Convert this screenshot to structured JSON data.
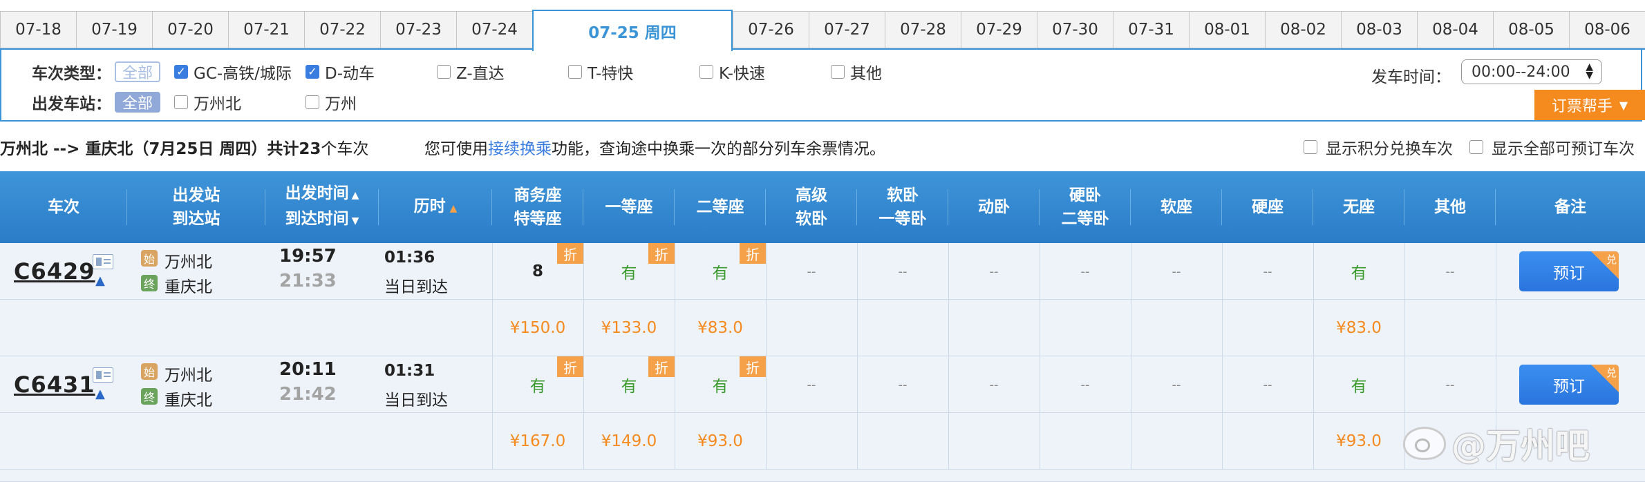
{
  "dates": [
    "07-18",
    "07-19",
    "07-20",
    "07-21",
    "07-22",
    "07-23",
    "07-24",
    "07-25 周四",
    "07-26",
    "07-27",
    "07-28",
    "07-29",
    "07-30",
    "07-31",
    "08-01",
    "08-02",
    "08-03",
    "08-04",
    "08-05",
    "08-06"
  ],
  "active_date_index": 7,
  "filters": {
    "type_label": "车次类型：",
    "all_label": "全部",
    "types": [
      {
        "label": "GC-高铁/城际",
        "checked": true
      },
      {
        "label": "D-动车",
        "checked": true
      },
      {
        "label": "Z-直达",
        "checked": false
      },
      {
        "label": "T-特快",
        "checked": false
      },
      {
        "label": "K-快速",
        "checked": false
      },
      {
        "label": "其他",
        "checked": false
      }
    ],
    "station_label": "出发车站：",
    "stations": [
      {
        "label": "万州北",
        "checked": false
      },
      {
        "label": "万州",
        "checked": false
      }
    ],
    "time_label": "发车时间：",
    "time_value": "00:00--24:00",
    "helper_label": "订票帮手"
  },
  "summary": {
    "route": "万州北 --> 重庆北（7月25日  周四）共计",
    "count": "23",
    "suffix": "个车次",
    "tip_pre": "您可使用",
    "tip_link": "接续换乘",
    "tip_post": "功能，查询途中换乘一次的部分列车余票情况。",
    "opt_points": "显示积分兑换车次",
    "opt_all": "显示全部可预订车次"
  },
  "headers": {
    "train": "车次",
    "station_a": "出发站",
    "station_b": "到达站",
    "time_a": "出发时间",
    "time_b": "到达时间",
    "duration": "历时",
    "business_a": "商务座",
    "business_b": "特等座",
    "first": "一等座",
    "second": "二等座",
    "adv_a": "高级",
    "adv_b": "软卧",
    "soft_a": "软卧",
    "soft_b": "一等卧",
    "moving": "动卧",
    "hard_a": "硬卧",
    "hard_b": "二等卧",
    "softseat": "软座",
    "hardseat": "硬座",
    "noseat": "无座",
    "other": "其他",
    "remark": "备注"
  },
  "trains": [
    {
      "no": "C6429",
      "from": "万州北",
      "to": "重庆北",
      "start_tag": "始",
      "end_tag": "终",
      "dep": "19:57",
      "arr": "21:33",
      "duration": "01:36",
      "arrive_note": "当日到达",
      "business": "8",
      "first": "有",
      "second": "有",
      "noseat": "有",
      "dash": "--",
      "discount": "折",
      "price_business": "¥150.0",
      "price_first": "¥133.0",
      "price_second": "¥83.0",
      "price_noseat": "¥83.0",
      "book": "预订",
      "book_tag": "兑"
    },
    {
      "no": "C6431",
      "from": "万州北",
      "to": "重庆北",
      "start_tag": "始",
      "end_tag": "终",
      "dep": "20:11",
      "arr": "21:42",
      "duration": "01:31",
      "arrive_note": "当日到达",
      "business": "有",
      "first": "有",
      "second": "有",
      "noseat": "有",
      "dash": "--",
      "discount": "折",
      "price_business": "¥167.0",
      "price_first": "¥149.0",
      "price_second": "¥93.0",
      "price_noseat": "¥93.0",
      "book": "预订",
      "book_tag": "兑"
    }
  ],
  "watermark": "@万州吧"
}
